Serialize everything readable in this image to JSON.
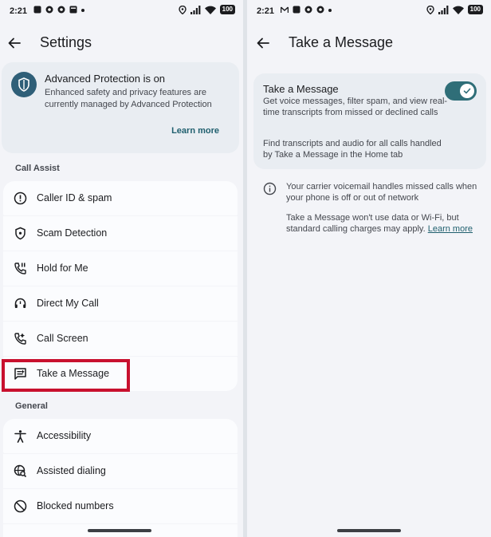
{
  "left": {
    "status": {
      "time": "2:21",
      "battery": "100"
    },
    "title": "Settings",
    "advanced_protection": {
      "title": "Advanced Protection is on",
      "description": "Enhanced safety and privacy features are currently managed by Advanced Protection",
      "learn_more": "Learn more"
    },
    "call_assist": {
      "header": "Call Assist",
      "items": [
        {
          "label": "Caller ID & spam",
          "icon": "alert-circle-icon"
        },
        {
          "label": "Scam Detection",
          "icon": "shield-icon"
        },
        {
          "label": "Hold for Me",
          "icon": "phone-hold-icon"
        },
        {
          "label": "Direct My Call",
          "icon": "headset-icon"
        },
        {
          "label": "Call Screen",
          "icon": "phone-screen-icon"
        },
        {
          "label": "Take a Message",
          "icon": "message-icon"
        }
      ]
    },
    "general": {
      "header": "General",
      "items": [
        {
          "label": "Accessibility",
          "icon": "accessibility-icon"
        },
        {
          "label": "Assisted dialing",
          "icon": "globe-search-icon"
        },
        {
          "label": "Blocked numbers",
          "icon": "block-icon"
        }
      ]
    }
  },
  "right": {
    "status": {
      "time": "2:21",
      "battery": "100"
    },
    "title": "Take a Message",
    "setting": {
      "title": "Take a Message",
      "description": "Get voice messages, filter spam, and view real-time transcripts from missed or declined calls",
      "description2": "Find transcripts and audio for all calls handled by Take a Message in the Home tab",
      "enabled": true
    },
    "info": {
      "text1": "Your carrier voicemail handles missed calls when your phone is off or out of network",
      "text2": "Take a Message won't use data or Wi-Fi, but standard calling charges may apply.",
      "link": "Learn more"
    }
  },
  "colors": {
    "accent": "#2f6e78",
    "highlight": "#c8102e",
    "background": "#f3f4f8",
    "card": "#e9edf2"
  }
}
